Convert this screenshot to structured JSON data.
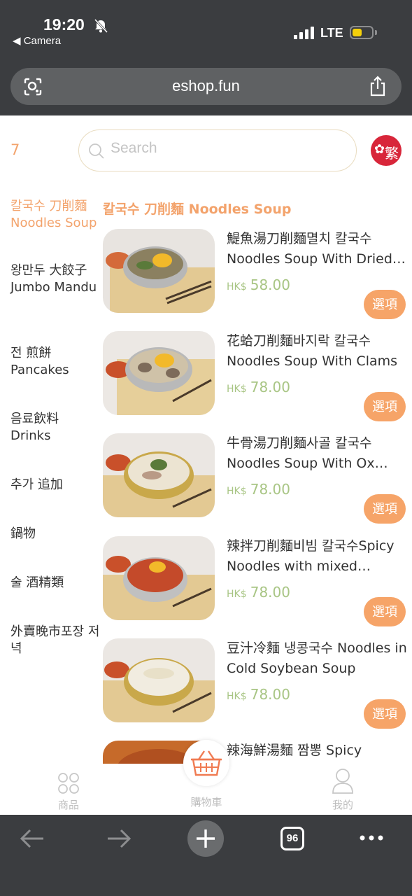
{
  "status_bar": {
    "time": "19:20",
    "back_app": "◀ Camera",
    "network": "LTE"
  },
  "browser": {
    "url": "eshop.fun",
    "tab_count": "96"
  },
  "header": {
    "cart_count": "7",
    "search_placeholder": "Search",
    "language_label": "繁"
  },
  "sidebar": {
    "categories": [
      {
        "label": "칼국수 刀削麵 Noodles Soup",
        "active": true
      },
      {
        "label": "왕만두 大餃子 Jumbo Mandu"
      },
      {
        "label": "전 煎餅 Pancakes"
      },
      {
        "label": "음료飲料 Drinks"
      },
      {
        "label": "추가 追加"
      },
      {
        "label": "鍋物"
      },
      {
        "label": "술 酒精類"
      },
      {
        "label": "外賣晚市포장 저녁"
      }
    ]
  },
  "section": {
    "title": "칼국수 刀削麵 Noodles Soup"
  },
  "products": [
    {
      "name_line1": "鯷魚湯刀削麵멸치 칼국수",
      "name_line2": "Noodles Soup With Dried…",
      "currency": "HK$",
      "price": "58.00",
      "option_label": "選項"
    },
    {
      "name_line1": "花蛤刀削麵바지락 칼국수",
      "name_line2": "Noodles Soup With Clams",
      "currency": "HK$",
      "price": "78.00",
      "option_label": "選項"
    },
    {
      "name_line1": "牛骨湯刀削麵사골 칼국수",
      "name_line2": "Noodles Soup With Ox…",
      "currency": "HK$",
      "price": "78.00",
      "option_label": "選項"
    },
    {
      "name_line1": "辣拌刀削麵비빔 칼국수Spicy",
      "name_line2": "Noodles with mixed…",
      "currency": "HK$",
      "price": "78.00",
      "option_label": "選項"
    },
    {
      "name_line1": "豆汁冷麵 냉콩국수 Noodles in",
      "name_line2": "Cold Soybean Soup",
      "currency": "HK$",
      "price": "78.00",
      "option_label": "選項"
    },
    {
      "name_line1": "辣海鮮湯麵 짬뽕 Spicy",
      "name_line2": "",
      "currency": "",
      "price": "",
      "option_label": ""
    }
  ],
  "bottom_nav": {
    "products_label": "商品",
    "cart_label": "購物車",
    "me_label": "我的"
  },
  "colors": {
    "accent": "#f3a36c",
    "price": "#a8c584",
    "option_button": "#f6a468",
    "chrome": "#3b3d40"
  }
}
